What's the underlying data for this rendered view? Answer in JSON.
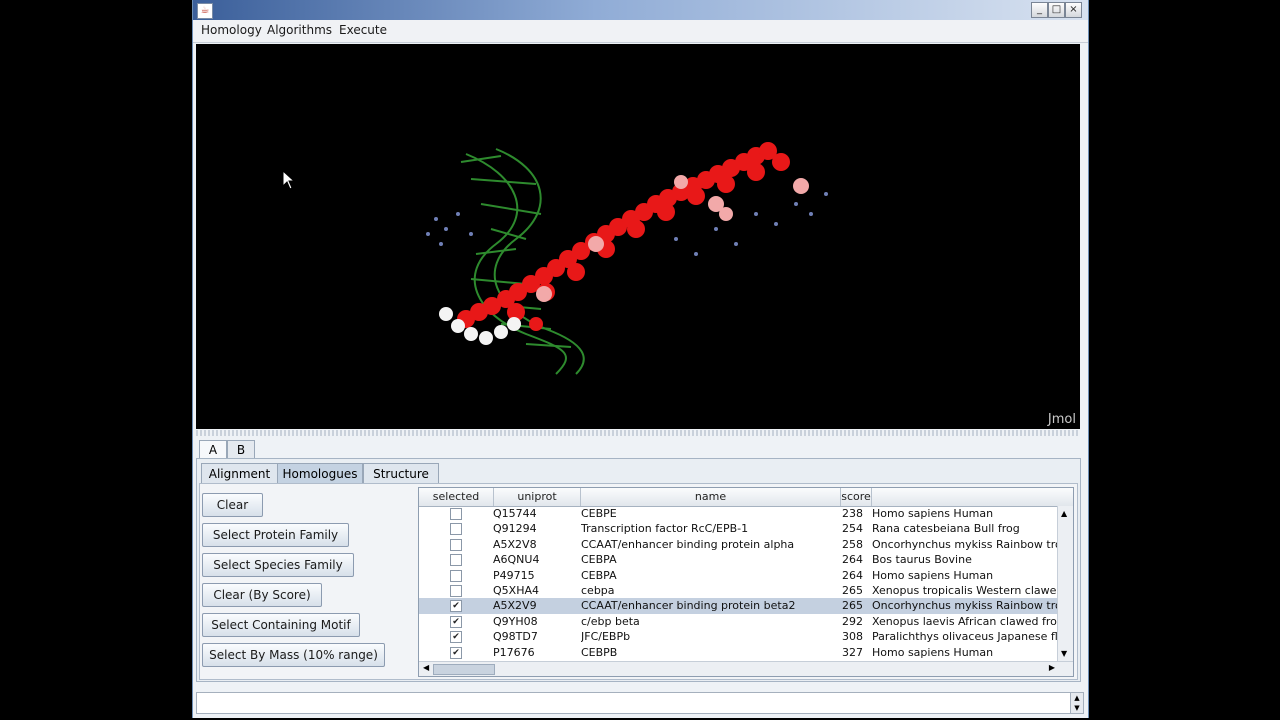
{
  "menu": [
    "Homology",
    "Algorithms",
    "Execute"
  ],
  "window_controls": {
    "minimize": "_",
    "maximize": "□",
    "close": "×"
  },
  "viewer": {
    "label": "Jmol"
  },
  "outer_tabs": [
    "A",
    "B"
  ],
  "inner_tabs": [
    "Alignment",
    "Homologues",
    "Structure"
  ],
  "active_inner_tab": "Homologues",
  "buttons": {
    "clear": "Clear",
    "select_protein_family": "Select Protein Family",
    "select_species_family": "Select Species Family",
    "clear_by_score": "Clear (By Score)",
    "select_containing_motif": "Select Containing Motif",
    "select_by_mass": "Select By Mass (10% range)"
  },
  "table": {
    "columns": [
      "selected",
      "uniprot",
      "name",
      "score"
    ],
    "rows": [
      {
        "selected": false,
        "uniprot": "Q15744",
        "name": "CEBPE",
        "score": "238",
        "species": "Homo sapiens Human"
      },
      {
        "selected": false,
        "uniprot": "Q91294",
        "name": "Transcription factor RcC/EPB-1",
        "score": "254",
        "species": "Rana catesbeiana Bull frog"
      },
      {
        "selected": false,
        "uniprot": "A5X2V8",
        "name": " CCAAT/enhancer binding protein alpha",
        "score": "258",
        "species": "Oncorhynchus mykiss Rainbow trou"
      },
      {
        "selected": false,
        "uniprot": "A6QNU4",
        "name": "CEBPA",
        "score": "264",
        "species": "Bos taurus Bovine"
      },
      {
        "selected": false,
        "uniprot": "P49715",
        "name": "CEBPA",
        "score": "264",
        "species": "Homo sapiens Human"
      },
      {
        "selected": false,
        "uniprot": "Q5XHA4",
        "name": "cebpa",
        "score": "265",
        "species": "Xenopus tropicalis Western clawed"
      },
      {
        "selected": true,
        "uniprot": "A5X2V9",
        "name": " CCAAT/enhancer binding protein beta2",
        "score": "265",
        "species": "Oncorhynchus mykiss Rainbow trou",
        "highlight": true
      },
      {
        "selected": true,
        "uniprot": "Q9YH08",
        "name": "c/ebp beta",
        "score": "292",
        "species": "Xenopus laevis African clawed frog"
      },
      {
        "selected": true,
        "uniprot": "Q98TD7",
        "name": "JFC/EBPb",
        "score": "308",
        "species": "Paralichthys olivaceus Japanese flo"
      },
      {
        "selected": true,
        "uniprot": "P17676",
        "name": "CEBPB",
        "score": "327",
        "species": "Homo sapiens Human"
      }
    ]
  },
  "colors": {
    "viewer_background": "#000000",
    "dna": "#2e8b2e",
    "protein_main": "#e81818",
    "protein_light": "#f2a9a9",
    "selected_row": "#c4d0e0"
  }
}
